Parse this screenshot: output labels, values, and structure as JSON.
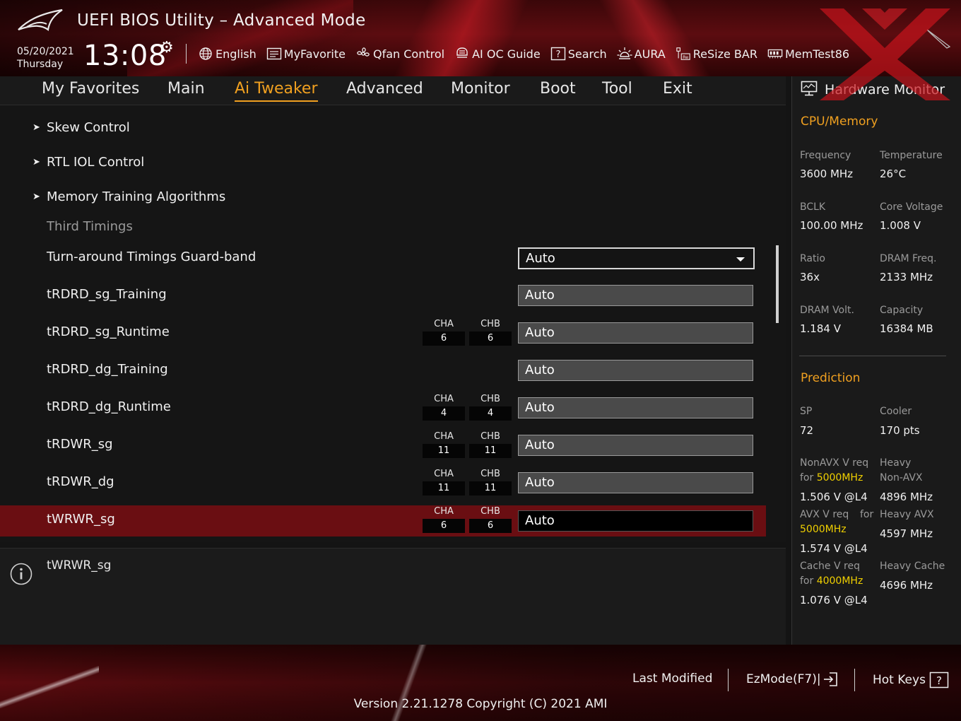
{
  "header": {
    "app_title": "UEFI BIOS Utility – Advanced Mode",
    "date": "05/20/2021",
    "day": "Thursday",
    "time": "13:08",
    "toolbar": [
      {
        "label": "English",
        "icon": "globe-icon"
      },
      {
        "label": "MyFavorite",
        "icon": "favorite-list-icon"
      },
      {
        "label": "Qfan Control",
        "icon": "fan-icon"
      },
      {
        "label": "AI OC Guide",
        "icon": "ai-oc-guide-icon"
      },
      {
        "label": "Search",
        "icon": "search-help-icon"
      },
      {
        "label": "AURA",
        "icon": "aura-light-icon"
      },
      {
        "label": "ReSize BAR",
        "icon": "resize-bar-icon"
      },
      {
        "label": "MemTest86",
        "icon": "memory-icon"
      }
    ]
  },
  "nav": {
    "tabs": [
      "My Favorites",
      "Main",
      "Ai Tweaker",
      "Advanced",
      "Monitor",
      "Boot",
      "Tool",
      "Exit"
    ],
    "active": "Ai Tweaker"
  },
  "settings": {
    "submenus": [
      "Skew Control",
      "RTL IOL Control",
      "Memory Training Algorithms"
    ],
    "section_title": "Third Timings",
    "items": [
      {
        "label": "Turn-around Timings Guard-band",
        "value": "Auto"
      },
      {
        "label": "tRDRD_sg_Training",
        "value": "Auto"
      },
      {
        "label": "tRDRD_sg_Runtime",
        "value": "Auto",
        "cha": "6",
        "chb": "6"
      },
      {
        "label": "tRDRD_dg_Training",
        "value": "Auto"
      },
      {
        "label": "tRDRD_dg_Runtime",
        "value": "Auto",
        "cha": "4",
        "chb": "4"
      },
      {
        "label": "tRDWR_sg",
        "value": "Auto",
        "cha": "11",
        "chb": "11"
      },
      {
        "label": "tRDWR_dg",
        "value": "Auto",
        "cha": "11",
        "chb": "11"
      },
      {
        "label": "tWRWR_sg",
        "value": "Auto",
        "cha": "6",
        "chb": "6"
      }
    ],
    "channel_a_label": "CHA",
    "channel_b_label": "CHB"
  },
  "help": {
    "text": "tWRWR_sg"
  },
  "hardware_monitor": {
    "title": "Hardware Monitor",
    "cpu_memory": {
      "title": "CPU/Memory",
      "frequency_label": "Frequency",
      "frequency": "3600 MHz",
      "temperature_label": "Temperature",
      "temperature": "26°C",
      "bclk_label": "BCLK",
      "bclk": "100.00 MHz",
      "core_voltage_label": "Core Voltage",
      "core_voltage": "1.008 V",
      "ratio_label": "Ratio",
      "ratio": "36x",
      "dram_freq_label": "DRAM Freq.",
      "dram_freq": "2133 MHz",
      "dram_volt_label": "DRAM Volt.",
      "dram_volt": "1.184 V",
      "capacity_label": "Capacity",
      "capacity": "16384 MB"
    },
    "prediction": {
      "title": "Prediction",
      "sp_label": "SP",
      "sp": "72",
      "cooler_label": "Cooler",
      "cooler": "170 pts",
      "nonavx_label": "NonAVX V req",
      "nonavx_for": "for",
      "nonavx_freq": "5000MHz",
      "nonavx_value": "1.506 V @L4",
      "heavy_nonavx_label_1": "Heavy",
      "heavy_nonavx_label_2": "Non-AVX",
      "heavy_nonavx_value": "4896 MHz",
      "avx_label": "AVX V req",
      "avx_for": "for",
      "avx_freq": "5000MHz",
      "avx_value": "1.574 V @L4",
      "heavy_avx_label": "Heavy AVX",
      "heavy_avx_value": "4597 MHz",
      "cache_label": "Cache V req",
      "cache_for": "for",
      "cache_freq": "4000MHz",
      "cache_value": "1.076 V @L4",
      "heavy_cache_label": "Heavy Cache",
      "heavy_cache_value": "4696 MHz"
    }
  },
  "footer": {
    "last_modified": "Last Modified",
    "ezmode": "EzMode(F7)|",
    "hot_keys": "Hot Keys",
    "version": "Version 2.21.1278 Copyright (C) 2021 AMI"
  },
  "colors": {
    "accent": "#f0a020",
    "brand_red": "#6a0e12",
    "highlight": "#f0d000"
  }
}
